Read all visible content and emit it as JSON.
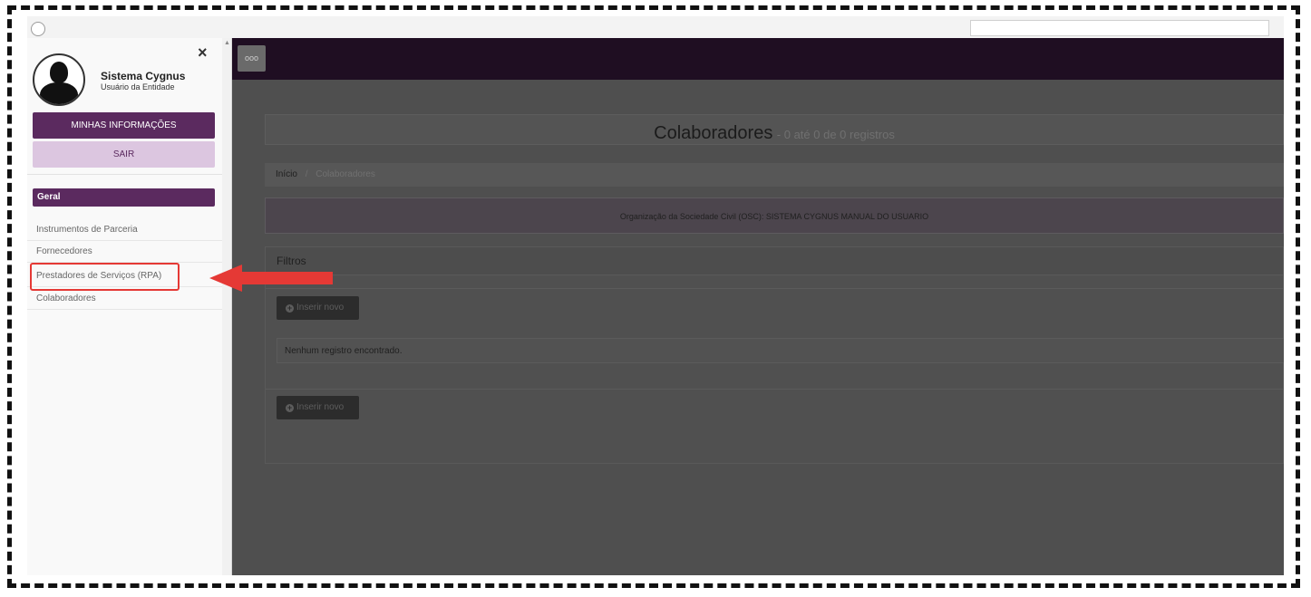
{
  "sidebar": {
    "close_icon": "×",
    "user": {
      "name": "Sistema Cygnus",
      "role": "Usuário da Entidade"
    },
    "buttons": {
      "info": "MINHAS INFORMAÇÕES",
      "logout": "SAIR"
    },
    "section_title": "Geral",
    "items": [
      {
        "label": "Instrumentos de Parceria"
      },
      {
        "label": "Fornecedores"
      },
      {
        "label": "Prestadores de Serviços (RPA)"
      },
      {
        "label": "Colaboradores"
      }
    ]
  },
  "topbar": {
    "menu_icon": "ooo"
  },
  "main": {
    "title": "Colaboradores",
    "subtitle": "- 0 até 0 de 0 registros",
    "breadcrumb": {
      "home": "Início",
      "separator": "/",
      "current": "Colaboradores"
    },
    "osc": "Organização da Sociedade Civil (OSC): SISTEMA CYGNUS MANUAL DO USUARIO",
    "filters_title": "Filtros",
    "insert_label": "Inserir novo",
    "empty_message": "Nenhum registro encontrado."
  },
  "colors": {
    "accent_purple": "#5b2a5f",
    "light_purple": "#dcc6e0",
    "topbar": "#1f0e22",
    "annotation_red": "#e53935"
  }
}
